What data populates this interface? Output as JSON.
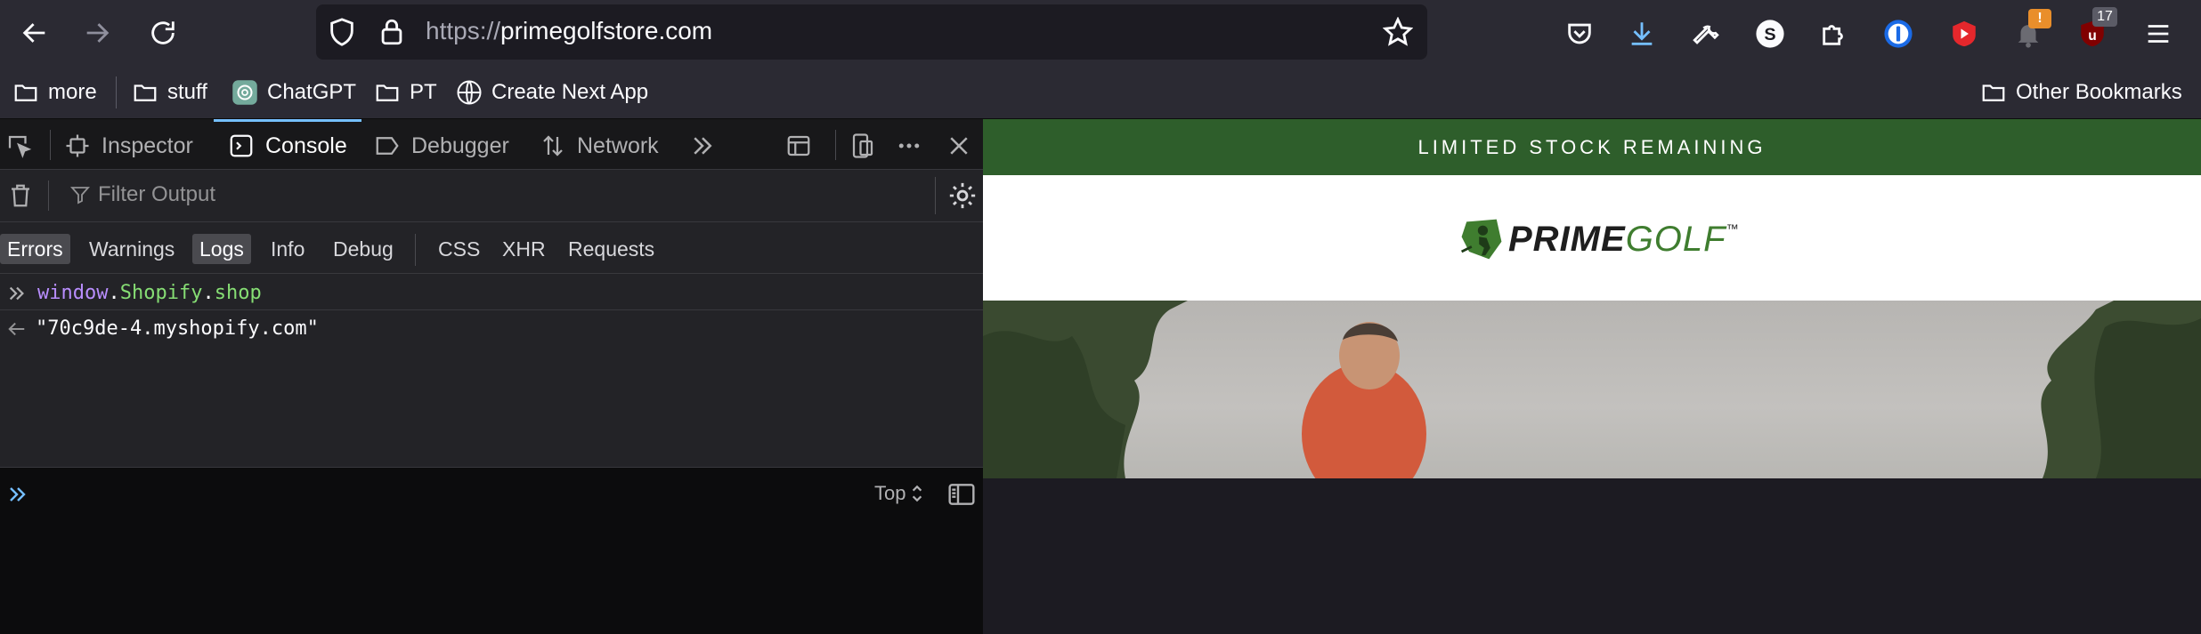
{
  "browser": {
    "url_protocol": "https://",
    "url_host": "primegolfstore.com",
    "badges": {
      "notification": "!",
      "ublock_count": "17"
    }
  },
  "bookmarks": {
    "items": [
      {
        "label": "more",
        "icon": "folder-icon"
      },
      {
        "label": "stuff",
        "icon": "folder-icon"
      },
      {
        "label": "ChatGPT",
        "icon": "chatgpt-icon"
      },
      {
        "label": "PT",
        "icon": "folder-icon"
      },
      {
        "label": "Create Next App",
        "icon": "globe-icon"
      }
    ],
    "other": "Other Bookmarks"
  },
  "devtools": {
    "tabs": {
      "inspector": "Inspector",
      "console": "Console",
      "debugger": "Debugger",
      "network": "Network"
    },
    "filter_placeholder": "Filter Output",
    "levels": [
      "Errors",
      "Warnings",
      "Logs",
      "Info",
      "Debug"
    ],
    "types": [
      "CSS",
      "XHR",
      "Requests"
    ],
    "console": {
      "input_obj": "window",
      "input_dot1": ".",
      "input_prop1": "Shopify",
      "input_dot2": ".",
      "input_prop2": "shop",
      "result": "\"70c9de-4.myshopify.com\"",
      "context": "Top"
    }
  },
  "page": {
    "banner": "LIMITED STOCK REMAINING",
    "logo_prime": "PRIME",
    "logo_golf": "GOLF",
    "logo_tm": "™"
  },
  "colors": {
    "banner_green": "#2e5e2b",
    "logo_green": "#3f7d2f",
    "accent_blue": "#75bfff"
  }
}
